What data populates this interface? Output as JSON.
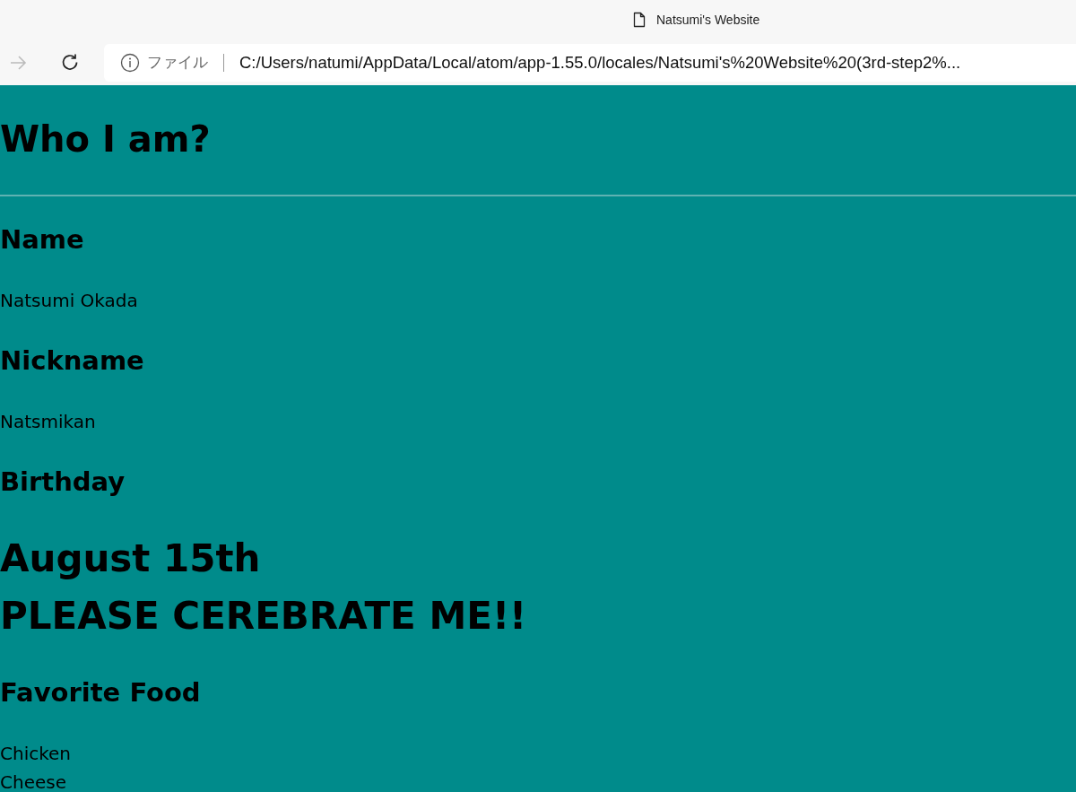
{
  "window": {
    "title": "Natsumi's Website"
  },
  "toolbar": {
    "buttons": [
      {
        "kind": "forward",
        "disabled": true
      },
      {
        "kind": "reload",
        "disabled": false
      }
    ],
    "address_bar": {
      "label": "ファイル",
      "url": "C:/Users/natumi/AppData/Local/atom/app-1.55.0/locales/Natsumi's%20Website%20(3rd-step2%..."
    }
  },
  "page": {
    "title": "Who I am?",
    "sections": [
      {
        "heading": "Name",
        "lines": [
          {
            "kind": "text",
            "text": "Natsumi Okada"
          }
        ]
      },
      {
        "heading": "Nickname",
        "lines": [
          {
            "kind": "text",
            "text": "Natsmikan"
          }
        ]
      },
      {
        "heading": "Birthday",
        "lines": [
          {
            "kind": "big",
            "text": "August 15th"
          },
          {
            "kind": "big",
            "text": "PLEASE CEREBRATE ME!!"
          }
        ]
      },
      {
        "heading": "Favorite Food",
        "lines": [
          {
            "kind": "text",
            "text": "Chicken"
          },
          {
            "kind": "text",
            "text": "Cheese"
          }
        ]
      }
    ]
  }
}
